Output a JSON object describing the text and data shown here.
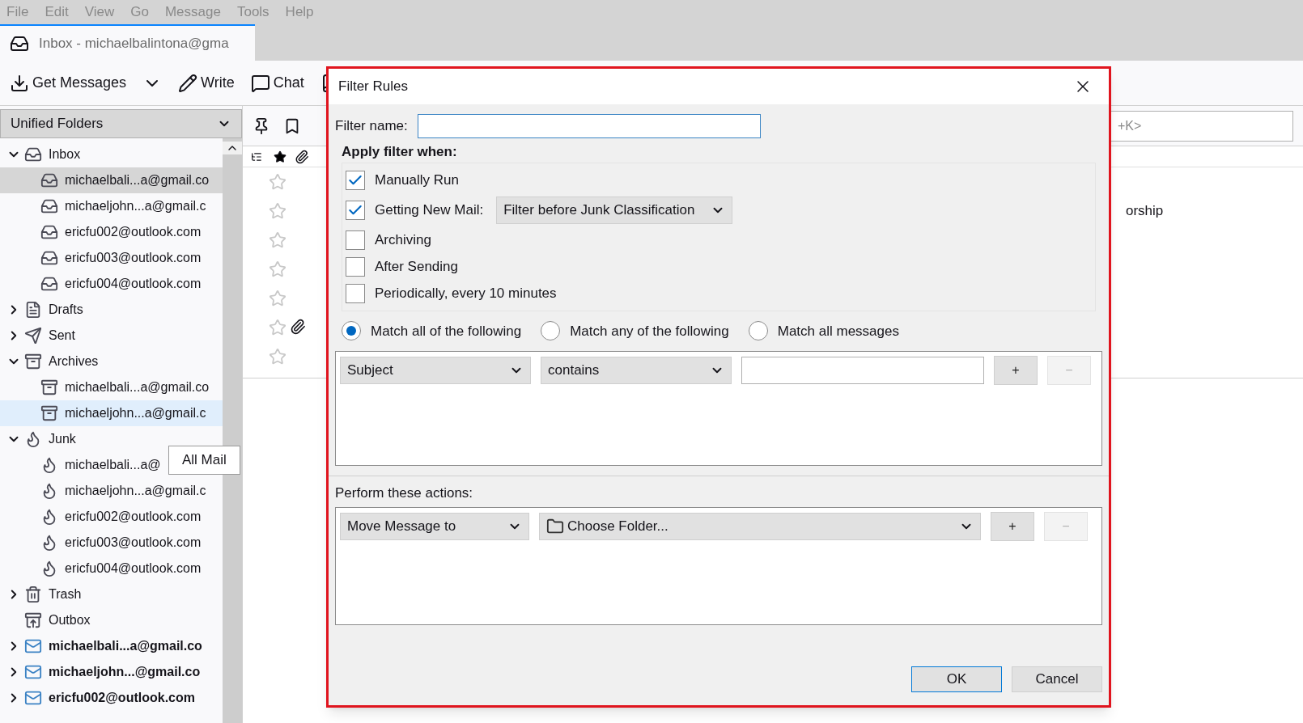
{
  "menu_bar": [
    "File",
    "Edit",
    "View",
    "Go",
    "Message",
    "Tools",
    "Help"
  ],
  "tab": {
    "title": "Inbox - michaelbalintona@gma"
  },
  "toolbar": [
    {
      "kind": "get-messages",
      "label": "Get Messages"
    },
    {
      "kind": "menu"
    },
    {
      "kind": "write",
      "label": "Write"
    },
    {
      "kind": "chat",
      "label": "Chat"
    },
    {
      "kind": "address-book"
    }
  ],
  "folder_pane": {
    "header": "Unified Folders",
    "folders": [
      {
        "label": "Inbox",
        "kind": "inbox",
        "expanded": true,
        "selected": false,
        "hovered": false,
        "children": [
          {
            "label": "michaelbali...a@gmail.co",
            "kind": "inbox",
            "selected": true,
            "hovered": false
          },
          {
            "label": "michaeljohn...a@gmail.c",
            "kind": "inbox",
            "selected": false,
            "hovered": false
          },
          {
            "label": "ericfu002@outlook.com",
            "kind": "inbox",
            "selected": false,
            "hovered": false
          },
          {
            "label": "ericfu003@outlook.com",
            "kind": "inbox",
            "selected": false,
            "hovered": false
          },
          {
            "label": "ericfu004@outlook.com",
            "kind": "inbox",
            "selected": false,
            "hovered": false
          }
        ]
      },
      {
        "label": "Drafts",
        "kind": "drafts",
        "expanded": false,
        "selected": false,
        "hovered": false
      },
      {
        "label": "Sent",
        "kind": "sent",
        "expanded": false,
        "selected": false,
        "hovered": false
      },
      {
        "label": "Archives",
        "kind": "archive",
        "expanded": true,
        "selected": false,
        "hovered": false,
        "children": [
          {
            "label": "michaelbali...a@gmail.co",
            "kind": "archive",
            "selected": false,
            "hovered": false
          },
          {
            "label": "michaeljohn...a@gmail.c",
            "kind": "archive",
            "selected": false,
            "hovered": true
          }
        ]
      },
      {
        "label": "Junk",
        "kind": "junk",
        "expanded": true,
        "selected": false,
        "hovered": false,
        "children": [
          {
            "label": "michaelbali...a@",
            "kind": "junk",
            "selected": false,
            "hovered": false
          },
          {
            "label": "michaeljohn...a@gmail.c",
            "kind": "junk",
            "selected": false,
            "hovered": false
          },
          {
            "label": "ericfu002@outlook.com",
            "kind": "junk",
            "selected": false,
            "hovered": false
          },
          {
            "label": "ericfu003@outlook.com",
            "kind": "junk",
            "selected": false,
            "hovered": false
          },
          {
            "label": "ericfu004@outlook.com",
            "kind": "junk",
            "selected": false,
            "hovered": false
          }
        ]
      },
      {
        "label": "Trash",
        "kind": "trash",
        "expanded": false,
        "selected": false,
        "hovered": false
      },
      {
        "label": "Outbox",
        "kind": "outbox",
        "selected": false,
        "hovered": false
      },
      {
        "label": "michaelbali...a@gmail.co",
        "kind": "account",
        "expanded": false,
        "selected": false,
        "hovered": false
      },
      {
        "label": "michaeljohn...@gmail.co",
        "kind": "account",
        "expanded": false,
        "selected": false,
        "hovered": false
      },
      {
        "label": "ericfu002@outlook.com",
        "kind": "account",
        "expanded": false,
        "selected": false,
        "hovered": false
      }
    ]
  },
  "tooltip": "All Mail",
  "search": {
    "placeholder": "+K>"
  },
  "message_list": {
    "rows": [
      {
        "starred": false,
        "attachment": false
      },
      {
        "starred": false,
        "attachment": false,
        "subject": "orship"
      },
      {
        "starred": false,
        "attachment": false
      },
      {
        "starred": false,
        "attachment": false
      },
      {
        "starred": false,
        "attachment": false
      },
      {
        "starred": false,
        "attachment": true
      },
      {
        "starred": false,
        "attachment": false
      }
    ]
  },
  "dialog": {
    "title": "Filter Rules",
    "filter_name": {
      "label": "Filter name:"
    },
    "apply_heading": "Apply filter when:",
    "apply_options": [
      {
        "label": "Manually Run",
        "checked": true
      },
      {
        "label": "Getting New Mail:",
        "checked": true,
        "dropdown": "Filter before Junk Classification"
      },
      {
        "label": "Archiving",
        "checked": false
      },
      {
        "label": "After Sending",
        "checked": false
      },
      {
        "label": "Periodically, every 10 minutes",
        "checked": false
      }
    ],
    "match": [
      {
        "label": "Match all of the following",
        "selected": true
      },
      {
        "label": "Match any of the following",
        "selected": false
      },
      {
        "label": "Match all messages",
        "selected": false
      }
    ],
    "conditions": [
      {
        "field": "Subject",
        "operator": "contains",
        "buttons": [
          {
            "label": "+",
            "disabled": false
          },
          {
            "label": "−",
            "disabled": true
          }
        ]
      }
    ],
    "actions_heading": "Perform these actions:",
    "actions": [
      {
        "action": "Move Message to",
        "target": "Choose Folder...",
        "buttons": [
          {
            "label": "+",
            "disabled": false
          },
          {
            "label": "−",
            "disabled": true
          }
        ]
      }
    ],
    "buttons": [
      {
        "label": "OK",
        "default": true
      },
      {
        "label": "Cancel",
        "default": false
      }
    ]
  }
}
